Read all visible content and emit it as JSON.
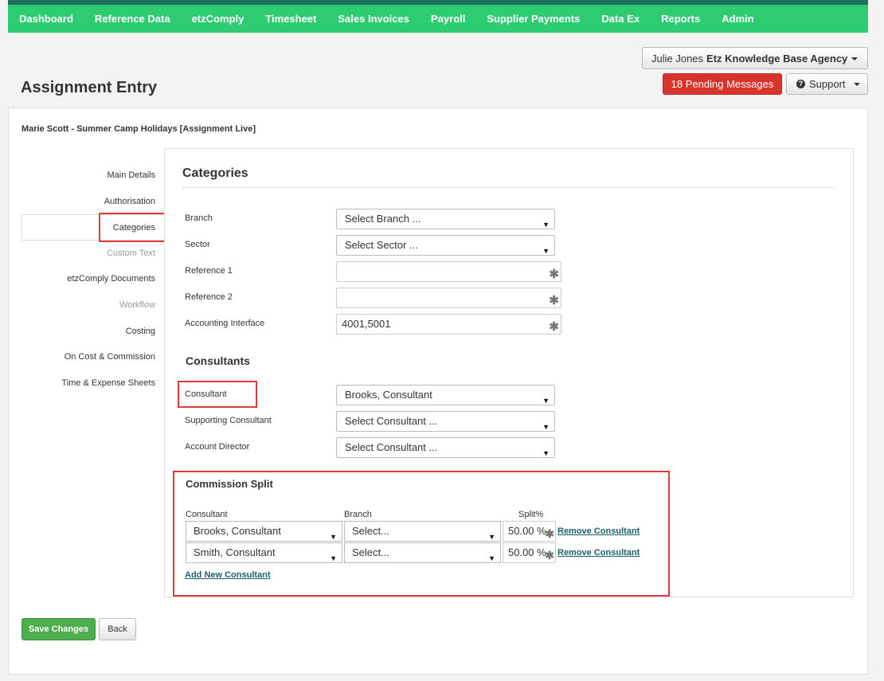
{
  "nav": {
    "items": [
      "Dashboard",
      "Reference Data",
      "etzComply",
      "Timesheet",
      "Sales Invoices",
      "Payroll",
      "Supplier Payments",
      "Data Ex",
      "Reports",
      "Admin"
    ]
  },
  "user": {
    "name": "Julie Jones",
    "agency": "Etz Knowledge Base Agency"
  },
  "header": {
    "messages_label": "18 Pending Messages",
    "support_label": "Support",
    "page_title": "Assignment Entry"
  },
  "assignment": {
    "title": "Marie Scott - Summer Camp Holidays [Assignment Live]"
  },
  "sidenav": {
    "items": [
      {
        "label": "Main Details",
        "state": "normal"
      },
      {
        "label": "Authorisation",
        "state": "normal"
      },
      {
        "label": "Categories",
        "state": "active"
      },
      {
        "label": "Custom Text",
        "state": "disabled"
      },
      {
        "label": "etzComply Documents",
        "state": "normal"
      },
      {
        "label": "Workflow",
        "state": "disabled"
      },
      {
        "label": "Costing",
        "state": "normal"
      },
      {
        "label": "On Cost & Commission",
        "state": "normal"
      },
      {
        "label": "Time & Expense Sheets",
        "state": "normal"
      }
    ]
  },
  "categories": {
    "title": "Categories",
    "branch": {
      "label": "Branch",
      "value": "Select Branch ..."
    },
    "sector": {
      "label": "Sector",
      "value": "Select Sector ..."
    },
    "reference1": {
      "label": "Reference 1",
      "value": ""
    },
    "reference2": {
      "label": "Reference 2",
      "value": ""
    },
    "accounting": {
      "label": "Accounting Interface",
      "value": "4001,5001"
    }
  },
  "consultants": {
    "title": "Consultants",
    "consultant": {
      "label": "Consultant",
      "value": "Brooks, Consultant"
    },
    "supporting": {
      "label": "Supporting Consultant",
      "value": "Select Consultant ..."
    },
    "director": {
      "label": "Account Director",
      "value": "Select Consultant ..."
    }
  },
  "commission_split": {
    "title": "Commission Split",
    "headers": {
      "consultant": "Consultant",
      "branch": "Branch",
      "split": "Split%"
    },
    "rows": [
      {
        "consultant": "Brooks, Consultant",
        "branch": "Select...",
        "split": "50.00 %",
        "remove_label": "Remove Consultant"
      },
      {
        "consultant": "Smith, Consultant",
        "branch": "Select...",
        "split": "50.00 %",
        "remove_label": "Remove Consultant"
      }
    ],
    "add_label": "Add New Consultant"
  },
  "actions": {
    "save_label": "Save Changes",
    "back_label": "Back"
  },
  "colors": {
    "nav_bg": "#2ecc71",
    "nav_border": "#1e6f5c",
    "danger": "#d9342b",
    "success": "#4cae4c",
    "highlight": "#e03a3a",
    "link": "#1d5f6e"
  },
  "icons": {
    "select_arrow": "▼",
    "required": "✱",
    "help": "?"
  }
}
